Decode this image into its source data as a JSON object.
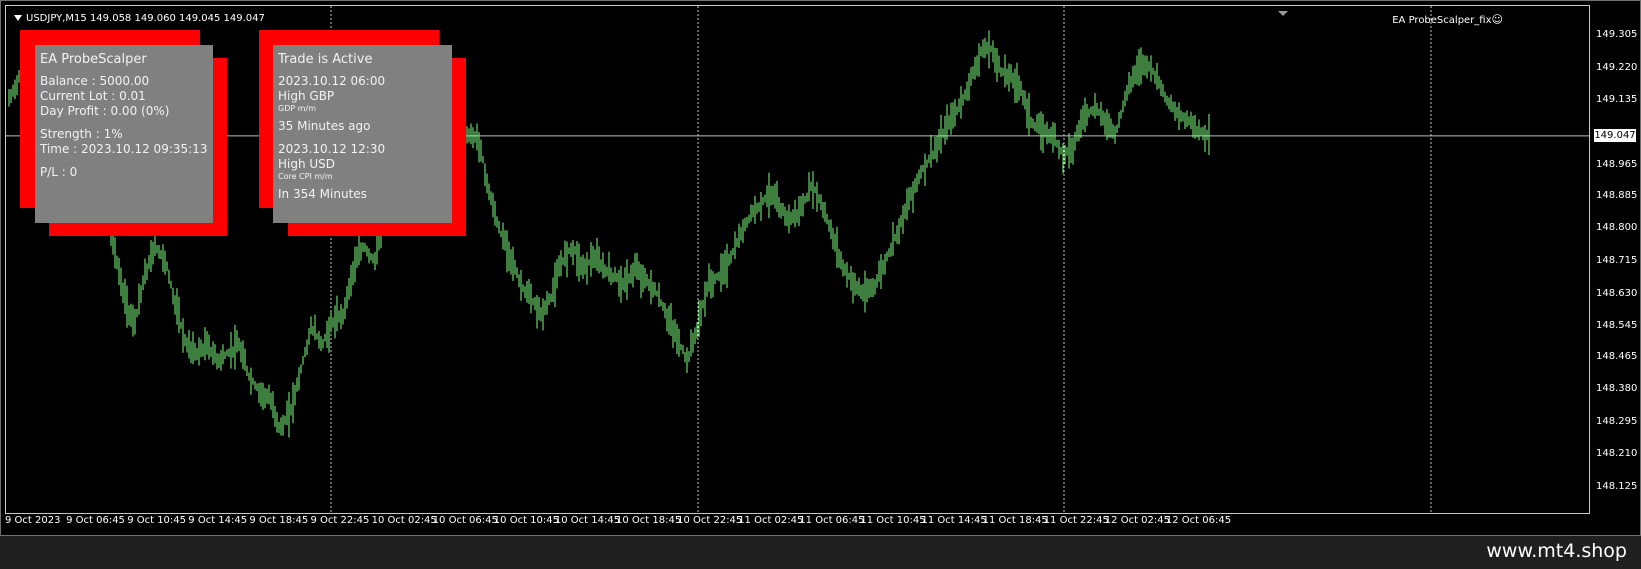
{
  "header": {
    "symbol_line": "USDJPY,M15  149.058 149.060 149.045 149.047",
    "ea_tag": "EA ProbeScalper_fix",
    "smiley": "☺"
  },
  "ea_panel": {
    "title": "EA ProbeScalper",
    "balance": "Balance : 5000.00",
    "current_lot": "Current Lot : 0.01",
    "day_profit": "Day Profit : 0.00 (0%)",
    "strength": "Strength : 1%",
    "time": "Time : 2023.10.12 09:35:13",
    "pl": "P/L : 0"
  },
  "news_panel": {
    "status": "Trade is Active",
    "status_color": "#22ff22",
    "event1_time": "2023.10.12 06:00",
    "event1_impact": "High GBP",
    "event1_name": "GDP m/m",
    "event1_relative": "35 Minutes ago",
    "event2_time": "2023.10.12 12:30",
    "event2_impact": "High USD",
    "event2_name": "Core CPI m/m",
    "event2_relative": "In 354 Minutes"
  },
  "price_axis": {
    "ticks": [
      "149.305",
      "149.220",
      "149.135",
      "148.965",
      "148.885",
      "148.800",
      "148.715",
      "148.630",
      "148.545",
      "148.465",
      "148.380",
      "148.295",
      "148.210",
      "148.125"
    ],
    "current_price": "149.047"
  },
  "time_axis": {
    "ticks": [
      "9 Oct 2023",
      "9 Oct 06:45",
      "9 Oct 10:45",
      "9 Oct 14:45",
      "9 Oct 18:45",
      "9 Oct 22:45",
      "10 Oct 02:45",
      "10 Oct 06:45",
      "10 Oct 10:45",
      "10 Oct 14:45",
      "10 Oct 18:45",
      "10 Oct 22:45",
      "11 Oct 02:45",
      "11 Oct 06:45",
      "11 Oct 10:45",
      "11 Oct 14:45",
      "11 Oct 18:45",
      "11 Oct 22:45",
      "12 Oct 02:45",
      "12 Oct 06:45"
    ]
  },
  "chart_data": {
    "type": "line",
    "series": [
      {
        "values": [
          149.14,
          149.2,
          149.16,
          149.12,
          149.1,
          149.09,
          149.05,
          148.98,
          148.92,
          148.86,
          148.76,
          148.63,
          148.55,
          148.68,
          148.76,
          148.72,
          148.6,
          148.5,
          148.48,
          148.5,
          148.46,
          148.48,
          148.5,
          148.42,
          148.38,
          148.36,
          148.28,
          148.33,
          148.44,
          148.55,
          148.5,
          148.56,
          148.58,
          148.7,
          148.76,
          148.72,
          148.82,
          148.96,
          149.02,
          148.92,
          148.88,
          148.93,
          148.96,
          149.03,
          149.05,
          149.04,
          148.9,
          148.8,
          148.74,
          148.66,
          148.62,
          148.58,
          148.63,
          148.72,
          148.76,
          148.7,
          148.73,
          148.7,
          148.68,
          148.66,
          148.7,
          148.67,
          148.64,
          148.58,
          148.52,
          148.46,
          148.55,
          148.66,
          148.68,
          148.72,
          148.78,
          148.84,
          148.87,
          148.9,
          148.85,
          148.83,
          148.86,
          148.92,
          148.86,
          148.78,
          148.7,
          148.66,
          148.63,
          148.66,
          148.72,
          148.79,
          148.86,
          148.93,
          148.98,
          149.02,
          149.08,
          149.12,
          149.18,
          149.26,
          149.28,
          149.22,
          149.2,
          149.17,
          149.08,
          149.06,
          149.05,
          149.0,
          149.02,
          149.1,
          149.12,
          149.09,
          149.05,
          149.15,
          149.22,
          149.24,
          149.2,
          149.14,
          149.1,
          149.09,
          149.06,
          149.05
        ]
      }
    ],
    "ylim": [
      148.125,
      149.305
    ],
    "grid": true
  },
  "colors": {
    "background": "#000000",
    "candle": "#7cfc7c",
    "panel_red": "#ff0000",
    "panel_gray": "#808080"
  },
  "footer": {
    "brand": "www.mt4.shop"
  }
}
